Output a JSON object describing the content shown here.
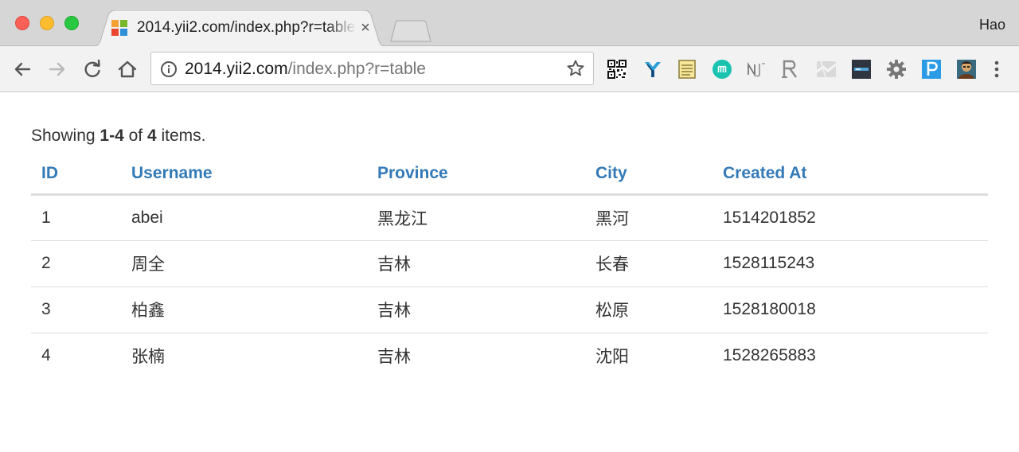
{
  "browser": {
    "tab": {
      "title": "2014.yii2.com/index.php?r=table",
      "close_glyph": "×"
    },
    "profile_name": "Hao",
    "url_host": "2014.yii2.com",
    "url_path": "/index.php?r=table",
    "extensions": [
      "qr-code-icon",
      "y-extension-icon",
      "notepad-icon",
      "m-extension-icon",
      "nj-extension-icon",
      "r-extension-icon",
      "map-extension-icon",
      "dark-extension-icon",
      "gear-extension-icon",
      "p-extension-icon",
      "avatar-extension-icon"
    ]
  },
  "colors": {
    "link": "#337ab7",
    "text": "#333333",
    "border": "#dddddd"
  },
  "summary": {
    "prefix": "Showing ",
    "range": "1-4",
    "middle": " of ",
    "total": "4",
    "suffix": " items."
  },
  "table": {
    "headers": [
      "ID",
      "Username",
      "Province",
      "City",
      "Created At"
    ],
    "rows": [
      [
        "1",
        "abei",
        "黑龙江",
        "黑河",
        "1514201852"
      ],
      [
        "2",
        "周全",
        "吉林",
        "长春",
        "1528115243"
      ],
      [
        "3",
        "柏鑫",
        "吉林",
        "松原",
        "1528180018"
      ],
      [
        "4",
        "张楠",
        "吉林",
        "沈阳",
        "1528265883"
      ]
    ]
  }
}
